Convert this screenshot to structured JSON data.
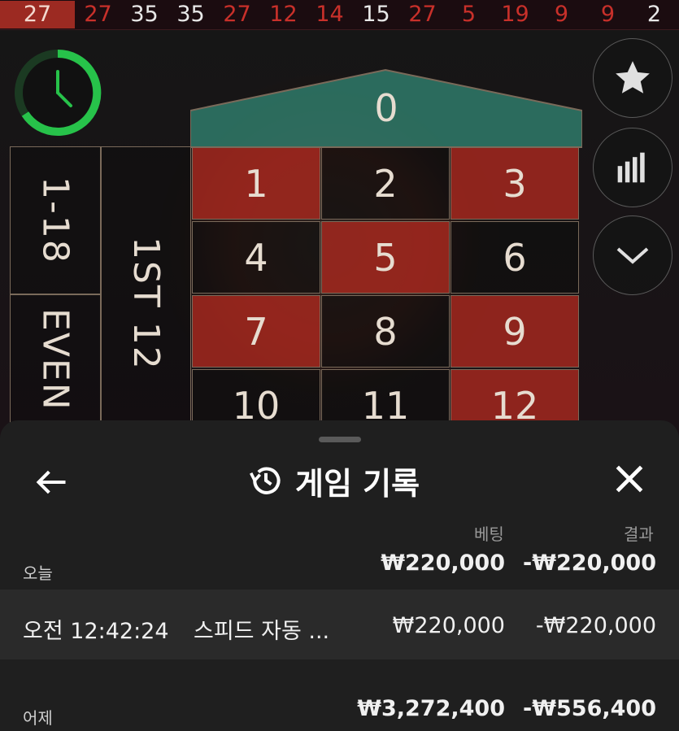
{
  "history": {
    "numbers": [
      {
        "value": "27",
        "color": "red"
      },
      {
        "value": "27",
        "color": "red"
      },
      {
        "value": "35",
        "color": "black"
      },
      {
        "value": "35",
        "color": "black"
      },
      {
        "value": "27",
        "color": "red"
      },
      {
        "value": "12",
        "color": "red"
      },
      {
        "value": "14",
        "color": "red"
      },
      {
        "value": "15",
        "color": "black"
      },
      {
        "value": "27",
        "color": "red"
      },
      {
        "value": "5",
        "color": "red"
      },
      {
        "value": "19",
        "color": "red"
      },
      {
        "value": "9",
        "color": "red"
      },
      {
        "value": "9",
        "color": "red"
      },
      {
        "value": "2",
        "color": "black"
      }
    ]
  },
  "table": {
    "zero": "0",
    "numbers": [
      {
        "value": "1",
        "color": "red"
      },
      {
        "value": "2",
        "color": "black"
      },
      {
        "value": "3",
        "color": "red"
      },
      {
        "value": "4",
        "color": "black"
      },
      {
        "value": "5",
        "color": "red"
      },
      {
        "value": "6",
        "color": "black"
      },
      {
        "value": "7",
        "color": "red"
      },
      {
        "value": "8",
        "color": "black"
      },
      {
        "value": "9",
        "color": "red"
      },
      {
        "value": "10",
        "color": "black"
      },
      {
        "value": "11",
        "color": "black"
      },
      {
        "value": "12",
        "color": "red"
      }
    ],
    "range_1_18": "1-18",
    "even": "EVEN",
    "dozen_first": "1ST 12"
  },
  "sheet": {
    "title": "게임 기록",
    "col_bet": "베팅",
    "col_result": "결과",
    "today": {
      "label": "오늘",
      "bet_total": "₩220,000",
      "result_total": "-₩220,000"
    },
    "rows": [
      {
        "time": "오전 12:42:24",
        "game": "스피드 자동 ...",
        "bet": "₩220,000",
        "result": "-₩220,000"
      }
    ],
    "yesterday": {
      "label": "어제",
      "bet_total": "₩3,272,400",
      "result_total": "-₩556,400"
    }
  },
  "icons": {
    "timer": "timer-icon",
    "favorite": "star-icon",
    "stats": "bar-chart-icon",
    "collapse": "chevron-down-icon",
    "back": "arrow-left-icon",
    "history": "history-icon",
    "close": "close-icon"
  },
  "colors": {
    "red": "#a8281e",
    "zero_green": "#2f7a6a",
    "timer_green": "#27c24a",
    "sheet_bg": "#1f1f1f"
  }
}
